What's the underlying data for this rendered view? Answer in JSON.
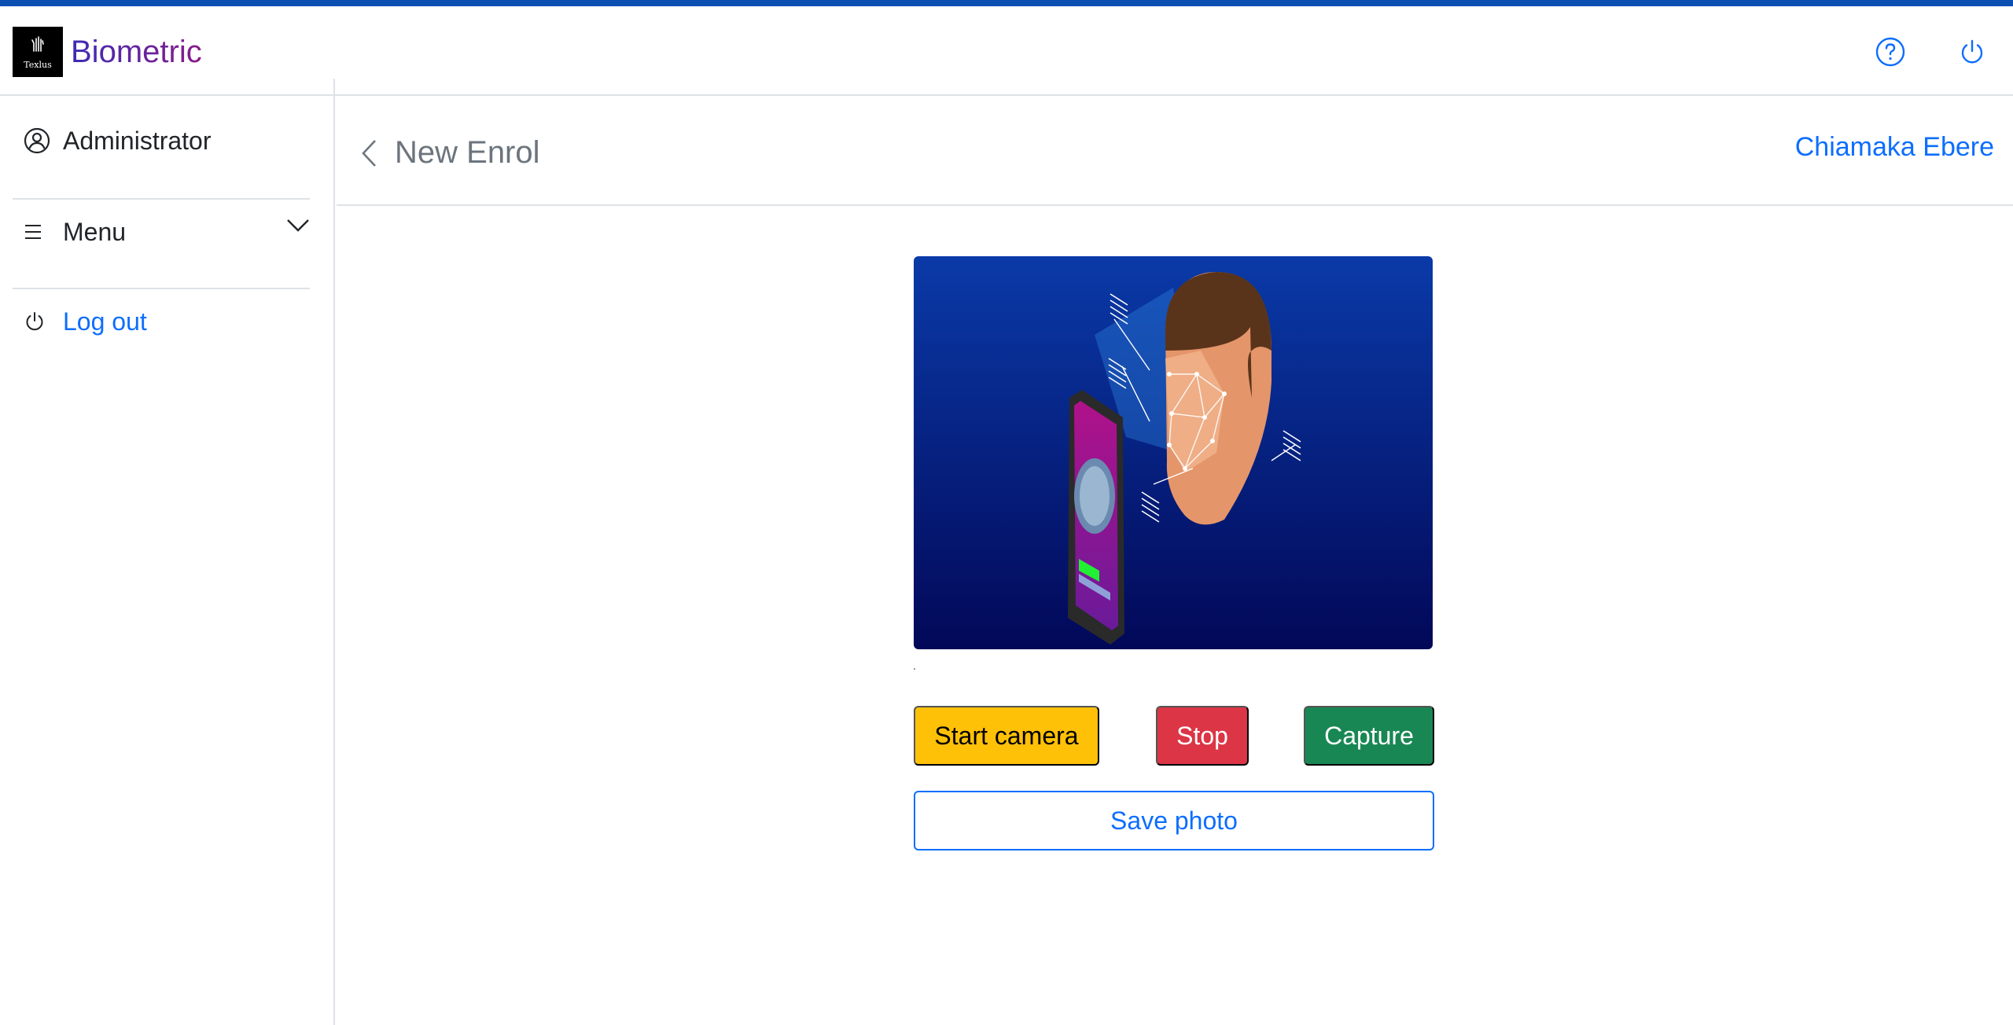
{
  "header": {
    "logo_text": "Texlus",
    "brand": "Biometric",
    "icons": [
      "help-circle-icon",
      "power-icon"
    ]
  },
  "sidebar": {
    "items": [
      {
        "label": "Administrator",
        "icon": "user-circle-icon"
      },
      {
        "label": "Menu",
        "icon": "hamburger-icon"
      },
      {
        "label": "Log out",
        "icon": "power-icon"
      }
    ]
  },
  "page": {
    "title": "New Enrol",
    "user_name": "Chiamaka Ebere"
  },
  "actions": {
    "start_camera": "Start camera",
    "stop": "Stop",
    "capture": "Capture",
    "save_photo": "Save photo"
  },
  "colors": {
    "accent": "#0b4fb3",
    "link": "#0d6efd",
    "start": "#ffc107",
    "stop": "#dc3545",
    "capture": "#198754"
  }
}
